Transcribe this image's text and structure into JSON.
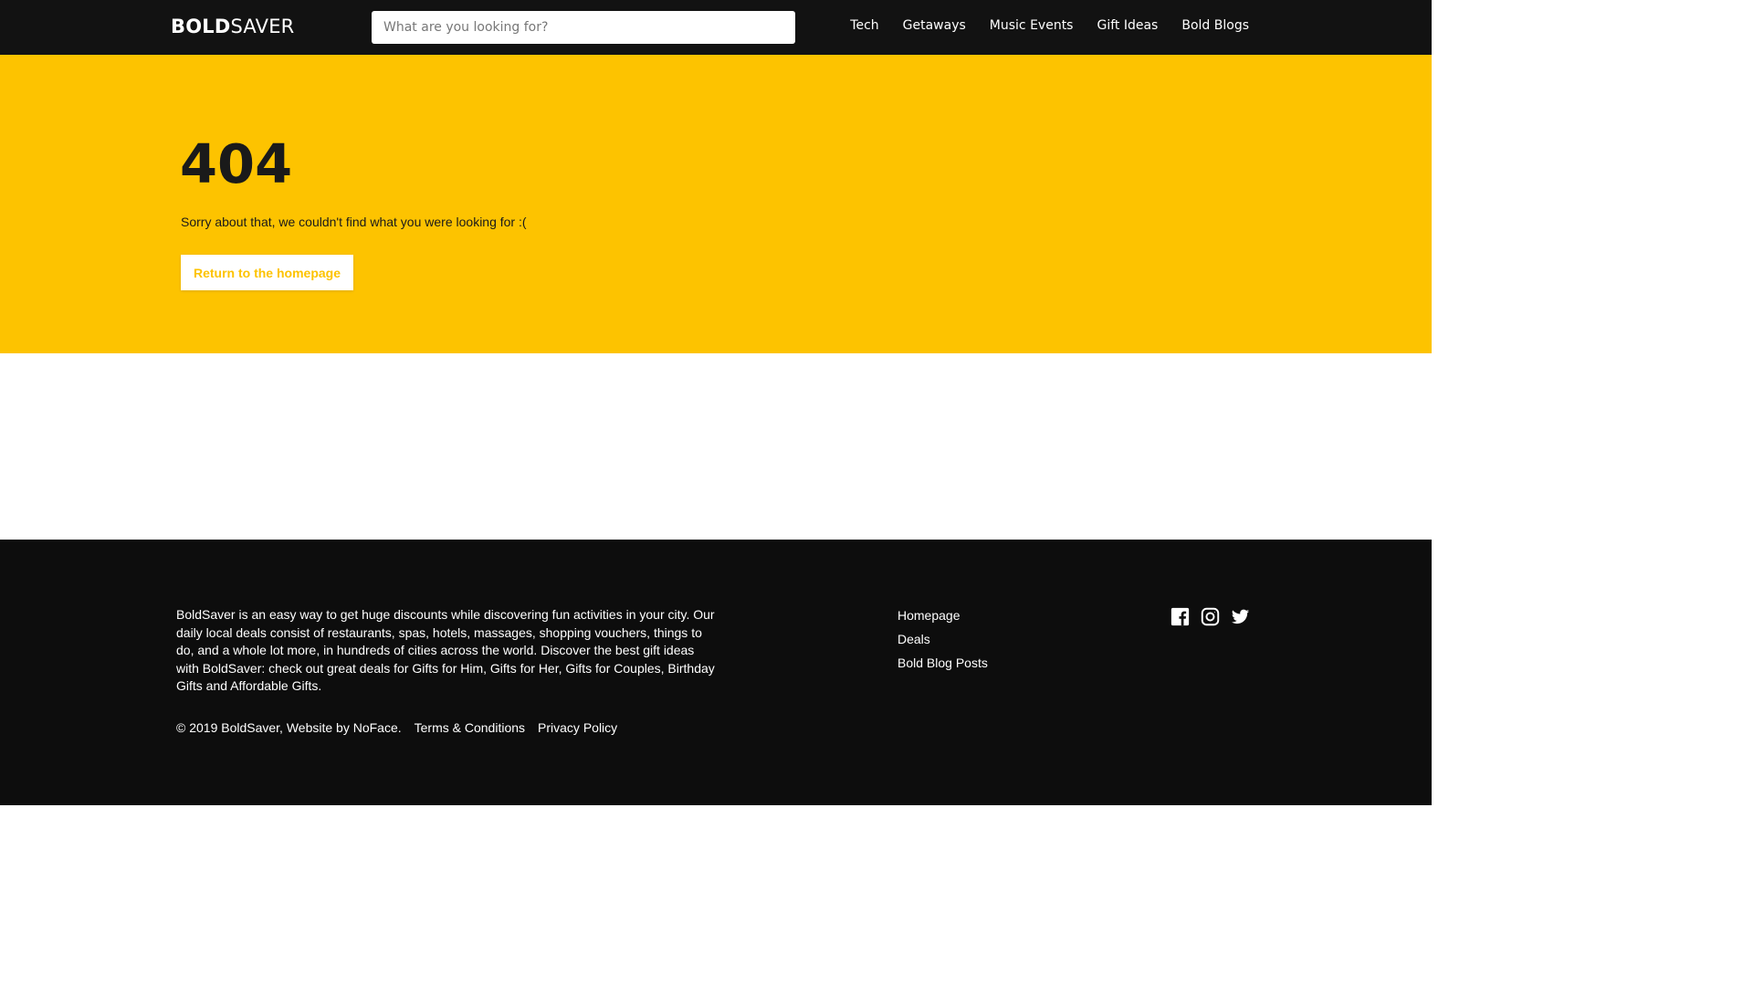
{
  "header": {
    "logo_bold": "BOLD",
    "logo_light": "SAVER",
    "search_placeholder": "What are you looking for?",
    "nav": [
      "Tech",
      "Getaways",
      "Music Events",
      "Gift Ideas",
      "Bold Blogs"
    ]
  },
  "error": {
    "code": "404",
    "message": "Sorry about that, we couldn't find what you were looking for :(",
    "button_label": "Return to the homepage"
  },
  "footer": {
    "about": "BoldSaver is an easy way to get huge discounts while discovering fun activities in your city. Our daily local deals consist of restaurants, spas, hotels, massages, shopping vouchers, things to do, and a whole lot more, in hundreds of cities across the world. Discover the best gift ideas with BoldSaver: check out great deals for Gifts for Him, Gifts for Her, Gifts for Couples, Birthday Gifts and Affordable Gifts.",
    "copyright": "© 2019 BoldSaver, Website by NoFace.",
    "terms": "Terms & Conditions",
    "privacy": "Privacy Policy",
    "links": [
      "Homepage",
      "Deals",
      "Bold Blog Posts"
    ],
    "social_icons": [
      "facebook-icon",
      "instagram-icon",
      "twitter-icon"
    ]
  },
  "colors": {
    "accent": "#fdc300",
    "header_bg": "#121212",
    "footer_bg": "#0d0d0d"
  }
}
